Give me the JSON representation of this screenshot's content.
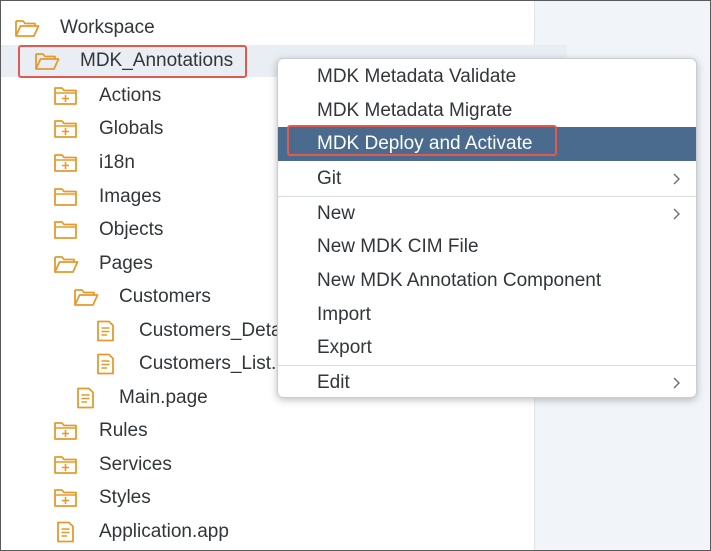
{
  "tree": {
    "root": {
      "label": "Workspace",
      "icon": "folder-open-icon"
    },
    "project": {
      "label": "MDK_Annotations",
      "icon": "folder-open-icon"
    },
    "items": [
      {
        "label": "Actions",
        "icon": "folder-plus-icon"
      },
      {
        "label": "Globals",
        "icon": "folder-plus-icon"
      },
      {
        "label": "i18n",
        "icon": "folder-plus-icon"
      },
      {
        "label": "Images",
        "icon": "folder-icon"
      },
      {
        "label": "Objects",
        "icon": "folder-icon"
      },
      {
        "label": "Pages",
        "icon": "folder-open-icon"
      },
      {
        "label": "Customers",
        "icon": "folder-open-icon"
      },
      {
        "label": "Customers_Deta",
        "icon": "file-icon"
      },
      {
        "label": "Customers_List.",
        "icon": "file-icon"
      },
      {
        "label": "Main.page",
        "icon": "file-icon"
      },
      {
        "label": "Rules",
        "icon": "folder-plus-icon"
      },
      {
        "label": "Services",
        "icon": "folder-plus-icon"
      },
      {
        "label": "Styles",
        "icon": "folder-plus-icon"
      },
      {
        "label": "Application.app",
        "icon": "file-icon"
      }
    ]
  },
  "context_menu": {
    "items": [
      {
        "label": "MDK Metadata Validate"
      },
      {
        "label": "MDK Metadata Migrate"
      },
      {
        "label": "MDK Deploy and Activate",
        "active": true
      },
      {
        "label": "Git",
        "submenu": true
      },
      {
        "label": "New",
        "submenu": true
      },
      {
        "label": "New MDK CIM File"
      },
      {
        "label": "New MDK Annotation Component"
      },
      {
        "label": "Import"
      },
      {
        "label": "Export"
      },
      {
        "label": "Edit",
        "submenu": true
      }
    ]
  },
  "colors": {
    "folder_icon": "#e69a2d",
    "highlight_border": "#e05a4e",
    "menu_active_bg": "#4a6b8d",
    "text": "#32363a"
  }
}
